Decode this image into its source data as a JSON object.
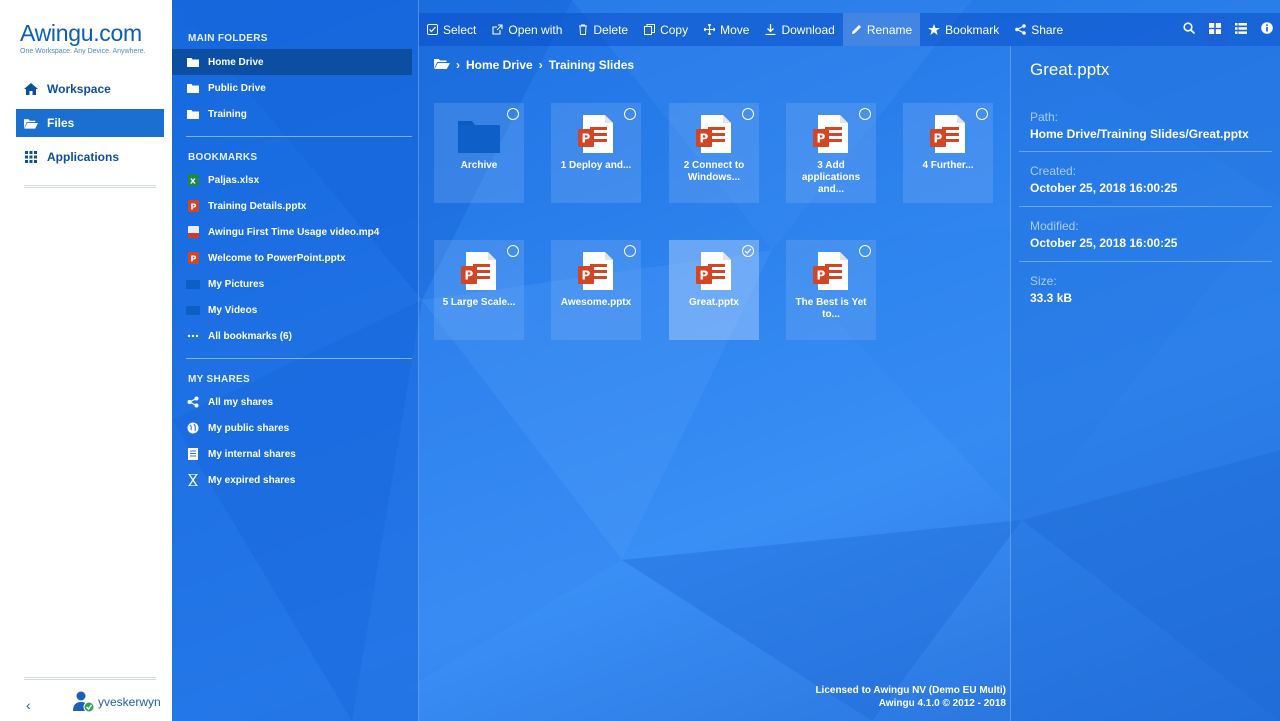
{
  "brand": {
    "name": "Awingu.com",
    "tagline": "One Workspace. Any Device. Anywhere."
  },
  "nav": [
    {
      "label": "Workspace",
      "icon": "home-icon"
    },
    {
      "label": "Files",
      "icon": "folder-open-icon",
      "active": true
    },
    {
      "label": "Applications",
      "icon": "grid-icon"
    }
  ],
  "user": {
    "name": "yveskerwyn",
    "collapse_glyph": "‹"
  },
  "folders": {
    "main_title": "MAIN FOLDERS",
    "main": [
      {
        "label": "Home Drive",
        "active": true
      },
      {
        "label": "Public Drive"
      },
      {
        "label": "Training"
      }
    ],
    "bookmarks_title": "BOOKMARKS",
    "bookmarks": [
      {
        "label": "Paljas.xlsx",
        "icon": "excel-icon"
      },
      {
        "label": "Training Details.pptx",
        "icon": "powerpoint-icon"
      },
      {
        "label": "Awingu First Time Usage video.mp4",
        "icon": "video-file-icon"
      },
      {
        "label": "Welcome to PowerPoint.pptx",
        "icon": "powerpoint-icon"
      },
      {
        "label": "My Pictures",
        "icon": "folder-icon"
      },
      {
        "label": "My Videos",
        "icon": "folder-icon"
      },
      {
        "label": "All bookmarks (6)",
        "icon": "ellipsis-icon"
      }
    ],
    "shares_title": "MY SHARES",
    "shares": [
      {
        "label": "All my shares",
        "icon": "share-icon"
      },
      {
        "label": "My public shares",
        "icon": "globe-icon"
      },
      {
        "label": "My internal shares",
        "icon": "document-icon"
      },
      {
        "label": "My expired shares",
        "icon": "hourglass-icon"
      }
    ]
  },
  "toolbar": {
    "select": "Select",
    "open_with": "Open with",
    "delete": "Delete",
    "copy": "Copy",
    "move": "Move",
    "download": "Download",
    "rename": "Rename",
    "bookmark": "Bookmark",
    "share": "Share"
  },
  "breadcrumb": [
    "Home Drive",
    "Training Slides"
  ],
  "files": [
    {
      "name": "Archive",
      "type": "folder"
    },
    {
      "name": "1 Deploy and...",
      "type": "pptx"
    },
    {
      "name": "2 Connect to Windows...",
      "type": "pptx"
    },
    {
      "name": "3 Add applications and...",
      "type": "pptx"
    },
    {
      "name": "4 Further...",
      "type": "pptx"
    },
    {
      "name": "5 Large Scale...",
      "type": "pptx"
    },
    {
      "name": "Awesome.pptx",
      "type": "pptx"
    },
    {
      "name": "Great.pptx",
      "type": "pptx",
      "selected": true
    },
    {
      "name": "The Best is Yet to...",
      "type": "pptx"
    }
  ],
  "details": {
    "title": "Great.pptx",
    "path_label": "Path:",
    "path": "Home Drive/Training Slides/Great.pptx",
    "created_label": "Created:",
    "created": "October 25, 2018 16:00:25",
    "modified_label": "Modified:",
    "modified": "October 25, 2018 16:00:25",
    "size_label": "Size:",
    "size": "33.3 kB"
  },
  "license": {
    "line1": "Licensed to Awingu NV (Demo EU Multi)",
    "line2": "Awingu 4.1.0 © 2012 - 2018"
  }
}
